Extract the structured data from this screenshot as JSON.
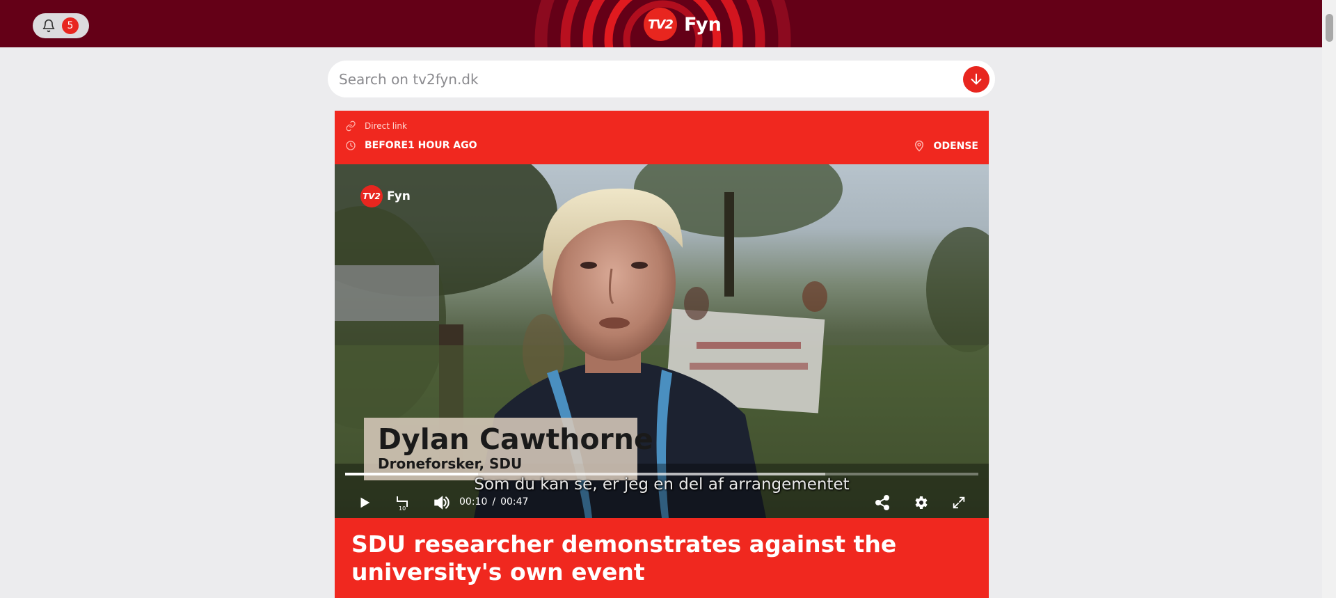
{
  "header": {
    "notifications_count": "5",
    "brand_logo_text": "TV2",
    "brand_name": "Fyn"
  },
  "search": {
    "placeholder": "Search on tv2fyn.dk"
  },
  "article": {
    "direct_link_label": "Direct link",
    "time_label": "BEFORE1 HOUR AGO",
    "location_label": "ODENSE",
    "headline_parts": [
      {
        "text": "SDU researcher ",
        "bold": false
      },
      {
        "text": "demonstrates",
        "bold": true
      },
      {
        "text": " against the university's ",
        "bold": false
      },
      {
        "text": "own event",
        "bold": true
      }
    ]
  },
  "video": {
    "logo_text": "TV2",
    "logo_name": "Fyn",
    "lower_third_name": "Dylan Cawthorne",
    "lower_third_role": "Droneforsker, SDU",
    "subtitle": "Som du kan se, er jeg en del af arrangementet",
    "current_time": "00:10",
    "time_separator": "/",
    "duration": "00:47",
    "progress_fraction": 0.21,
    "buffered_fraction": 0.758,
    "icons": [
      "play-icon",
      "replay-10-icon",
      "volume-icon",
      "share-icon",
      "settings-icon",
      "fullscreen-icon"
    ]
  },
  "colors": {
    "header_bg": "#640017",
    "accent_red": "#e8261f",
    "card_red": "#f0281f",
    "page_bg": "#ececee"
  }
}
